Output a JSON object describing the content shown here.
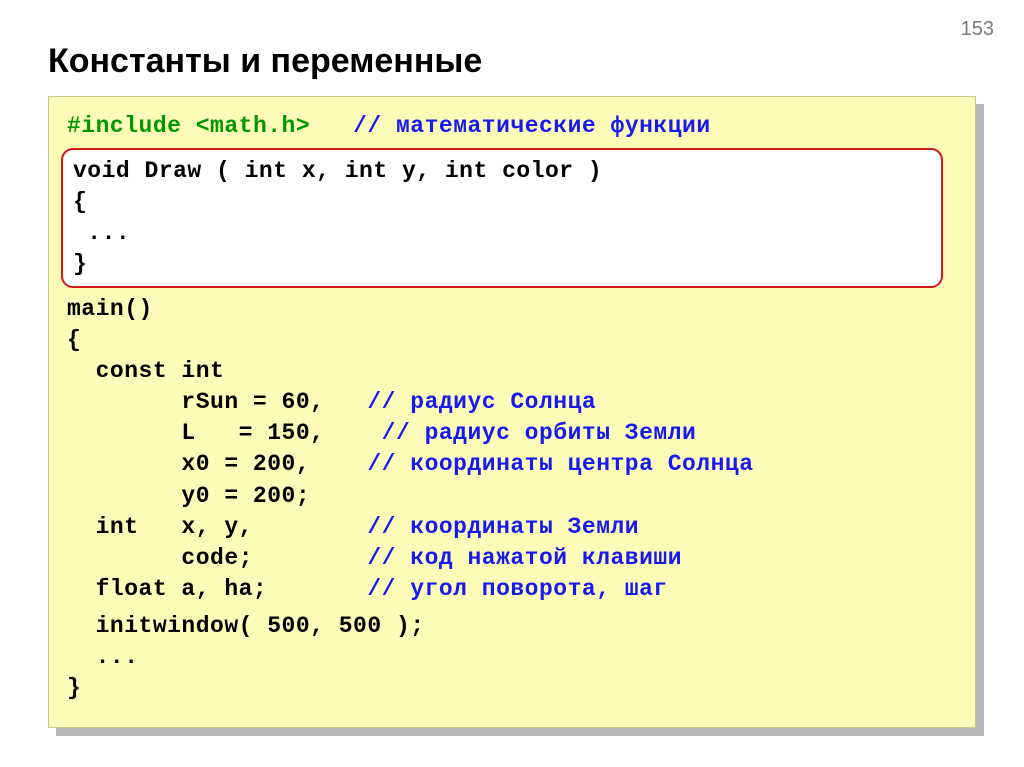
{
  "slide": {
    "page_number": "153",
    "title": "Константы и переменные"
  },
  "code": {
    "include_pre": "#include ",
    "include_hdr": "<math.h>",
    "include_pad": "   ",
    "include_com": "// математические функции",
    "draw_sig": "void Draw ( int x, int y, int color )",
    "brace_open": "{",
    "ellipsis": " ...",
    "brace_close": "}",
    "main_sig": "main()",
    "main_open": "{",
    "const_int": "  const int",
    "rsun_pre": "        rSun = 60,   ",
    "rsun_com": "// радиус Солнца",
    "L_pre": "        L   = 150,    ",
    "L_com": "// радиус орбиты Земли",
    "x0_pre": "        x0 = 200,    ",
    "x0_com": "// координаты центра Солнца",
    "y0_pre": "        y0 = 200;",
    "int_pre": "  int   x, y,        ",
    "int_com": "// координаты Земли",
    "code_pre": "        code;        ",
    "code_com": "// код нажатой клавиши",
    "float_pre": "  float a, ha;       ",
    "float_com": "// угол поворота, шаг",
    "initwin": "  initwindow( 500, 500 );",
    "main_ellipsis": "  ...",
    "main_close": "}"
  }
}
